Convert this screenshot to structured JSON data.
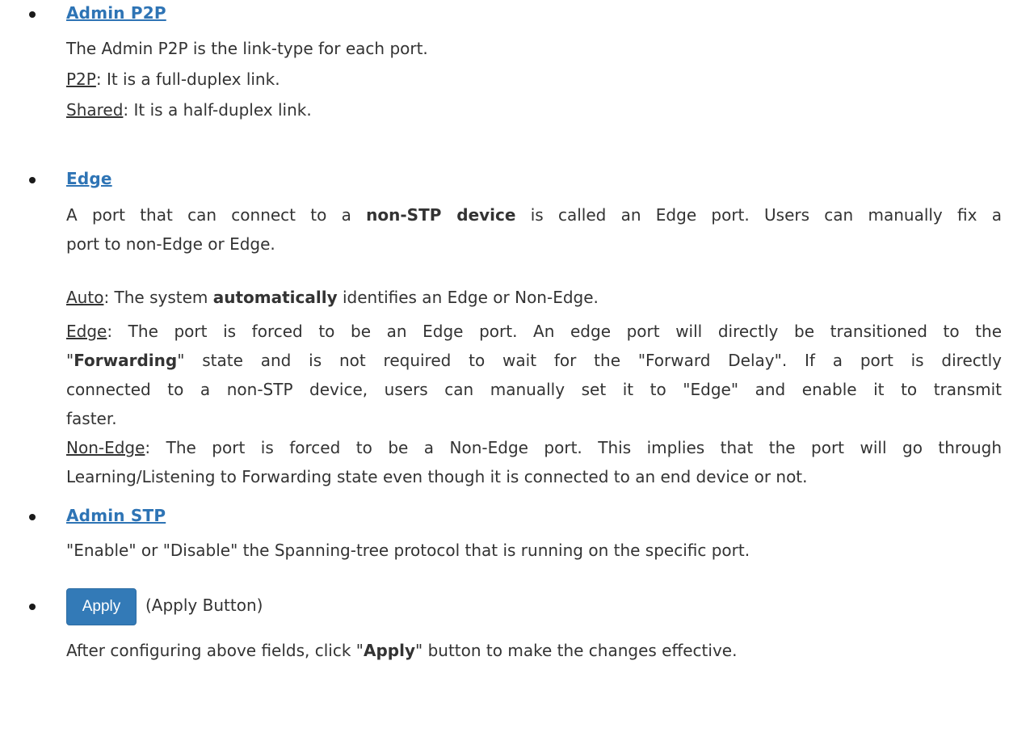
{
  "sections": {
    "admin_p2p": {
      "title": "Admin P2P",
      "desc": "The Admin P2P is the link-type for each port.",
      "opt1_term": "P2P",
      "opt1_text": ": It is a full-duplex link.",
      "opt2_term": "Shared",
      "opt2_text": ": It is a half-duplex link."
    },
    "edge": {
      "title": "Edge",
      "p1_a": "A port that can connect to a ",
      "p1_bold": "non-STP device",
      "p1_b": " is called an Edge port. Users can manually fix a",
      "p1_c": "port to non-Edge or Edge.",
      "auto_term": "Auto",
      "auto_a": ": The system ",
      "auto_bold": "automatically",
      "auto_b": " identifies an Edge or Non-Edge.",
      "edge_term": "Edge",
      "edge_a": ": The port is forced to be an Edge port. An edge port will directly be transitioned to the",
      "edge_b1": "\"",
      "edge_bold": "Forwarding",
      "edge_b2": "\" state and is not required to wait for the \"Forward Delay\". If a port is directly",
      "edge_c": "connected to a non-STP device, users can manually set it to \"Edge\" and enable it to transmit",
      "edge_d": "faster.",
      "nonedge_term": "Non-Edge",
      "nonedge_a": ": The port is forced to be a Non-Edge port. This implies that the port will go through",
      "nonedge_b": "Learning/Listening to Forwarding state even though it is connected to an end device or not."
    },
    "admin_stp": {
      "title": "Admin STP",
      "desc": "\"Enable\" or \"Disable\" the Spanning-tree protocol that is running on the specific port."
    },
    "apply": {
      "button_label": "Apply",
      "caption": "(Apply Button)",
      "desc_a": "After configuring above fields, click \"",
      "desc_bold": "Apply",
      "desc_b": "\" button to make the changes effective."
    }
  },
  "colors": {
    "heading": "#2e74b5",
    "button": "#337ab7",
    "text": "#333333"
  }
}
